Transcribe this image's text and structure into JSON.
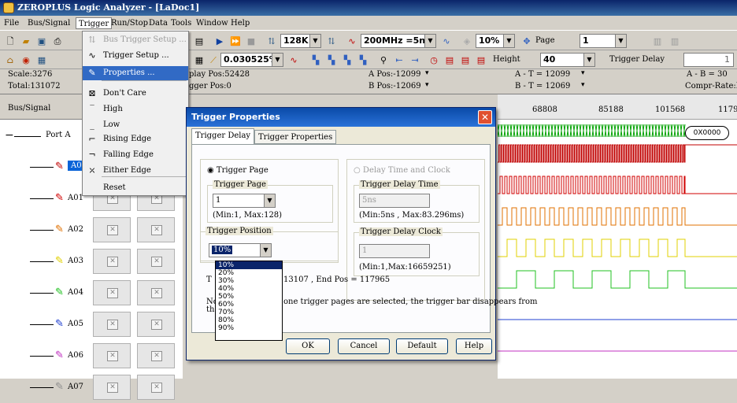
{
  "title": "ZEROPLUS Logic Analyzer - [LaDoc1]",
  "menu": [
    "File",
    "Bus/Signal",
    "Trigger",
    "Run/Stop",
    "Data",
    "Tools",
    "Window",
    "Help"
  ],
  "toolbar1": {
    "memory": "128K",
    "freq": "200MHz =5ns",
    "trigger_pct": "10%",
    "page_label": "Page",
    "page_value": "1"
  },
  "toolbar2": {
    "zoom": "0.030525%",
    "height_label": "Height",
    "height_value": "40",
    "trigger_delay_label": "Trigger Delay",
    "trigger_delay_value": "1"
  },
  "status": {
    "scale": "Scale:3276",
    "total": "Total:131072",
    "display_pos": "play Pos:52428",
    "trigger_pos": "gger Pos:0",
    "a_pos": "A Pos:-12099",
    "b_pos": "B Pos:-12069",
    "a_minus_t": "A - T = 12099",
    "b_minus_t": "B - T = 12069",
    "a_minus_b": "A - B = 30",
    "compr": "Compr-Rate:No"
  },
  "signal_header": "Bus/Signal",
  "port_label": "Port A",
  "signals": [
    "A00",
    "A01",
    "A02",
    "A03",
    "A04",
    "A05",
    "A06",
    "A07"
  ],
  "signal_colors": [
    "#c00000",
    "#d00000",
    "#e07000",
    "#e0d000",
    "#20c020",
    "#2040d0",
    "#c030c0",
    "#909090"
  ],
  "ruler": [
    "68808",
    "85188",
    "101568",
    "1179"
  ],
  "bus_value": "0X0000",
  "trigger_menu": {
    "items": [
      {
        "label": "Bus Trigger Setup ...",
        "disabled": true,
        "icon": "bus-trigger-icon"
      },
      {
        "label": "Trigger Setup ...",
        "disabled": false,
        "icon": "trigger-setup-icon"
      },
      {
        "label": "Properties ...",
        "disabled": false,
        "highlight": true,
        "icon": "properties-icon"
      },
      {
        "label": "Don't Care",
        "disabled": false,
        "icon": "dont-care-icon"
      },
      {
        "label": "High",
        "disabled": false,
        "icon": "high-icon"
      },
      {
        "label": "Low",
        "disabled": false,
        "icon": "low-icon"
      },
      {
        "label": "Rising Edge",
        "disabled": false,
        "icon": "rising-edge-icon"
      },
      {
        "label": "Falling Edge",
        "disabled": false,
        "icon": "falling-edge-icon"
      },
      {
        "label": "Either Edge",
        "disabled": false,
        "icon": "either-edge-icon"
      },
      {
        "label": "Reset",
        "disabled": false,
        "icon": ""
      }
    ]
  },
  "dialog": {
    "title": "Trigger Properties",
    "tabs": [
      "Trigger Delay",
      "Trigger Properties"
    ],
    "trigger_page_radio": "Trigger Page",
    "trigger_page_group": "Trigger Page",
    "trigger_page_value": "1",
    "trigger_page_range": "(Min:1, Max:128)",
    "delay_radio": "Delay Time and Clock",
    "delay_time_group": "Trigger Delay Time",
    "delay_time_value": "5ns",
    "delay_time_range": "(Min:5ns , Max:83.296ms)",
    "delay_clock_group": "Trigger Delay Clock",
    "delay_clock_value": "1",
    "delay_clock_range": "(Min:1,Max:16659251)",
    "position_group": "Trigger Position",
    "position_value": "10%",
    "pos_info_prefix": "T",
    "pos_info": "13107 , End Pos = 117965",
    "note_prefix": "No",
    "note_prefix2": "the",
    "note_text": "one trigger pages are selected, the trigger bar disappears from",
    "percent_options": [
      "10%",
      "20%",
      "30%",
      "40%",
      "50%",
      "60%",
      "70%",
      "80%",
      "90%"
    ],
    "buttons": {
      "ok": "OK",
      "cancel": "Cancel",
      "default": "Default",
      "help": "Help"
    }
  }
}
